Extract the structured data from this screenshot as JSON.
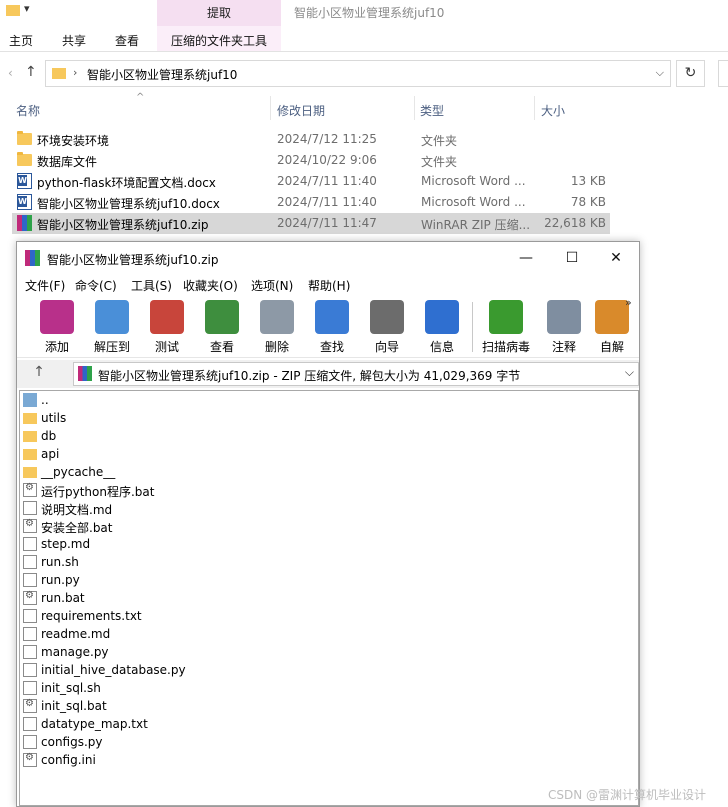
{
  "explorer": {
    "window_title": "智能小区物业管理系统juf10",
    "context_tab_group": "提取",
    "tabs": [
      "主页",
      "共享",
      "查看",
      "压缩的文件夹工具"
    ],
    "address": "智能小区物业管理系统juf10",
    "columns": [
      "名称",
      "修改日期",
      "类型",
      "大小"
    ],
    "files": [
      {
        "name": "环境安装环境",
        "date": "2024/7/12 11:25",
        "type": "文件夹",
        "size": "",
        "icon": "folder-icon"
      },
      {
        "name": "数据库文件",
        "date": "2024/10/22 9:06",
        "type": "文件夹",
        "size": "",
        "icon": "folder-icon"
      },
      {
        "name": "python-flask环境配置文档.docx",
        "date": "2024/7/11 11:40",
        "type": "Microsoft Word ...",
        "size": "13 KB",
        "icon": "word-icon"
      },
      {
        "name": "智能小区物业管理系统juf10.docx",
        "date": "2024/7/11 11:40",
        "type": "Microsoft Word ...",
        "size": "78 KB",
        "icon": "word-icon"
      },
      {
        "name": "智能小区物业管理系统juf10.zip",
        "date": "2024/7/11 11:47",
        "type": "WinRAR ZIP 压缩...",
        "size": "22,618 KB",
        "icon": "winrar-icon",
        "selected": true
      }
    ]
  },
  "winrar": {
    "title": "智能小区物业管理系统juf10.zip",
    "window_buttons": [
      "—",
      "☐",
      "✕"
    ],
    "menu": [
      "文件(F)",
      "命令(C)",
      "工具(S)",
      "收藏夹(O)",
      "选项(N)",
      "帮助(H)"
    ],
    "toolbar": [
      {
        "label": "添加",
        "icon": "add-archive-icon",
        "color": "#b8308a"
      },
      {
        "label": "解压到",
        "icon": "extract-folder-icon",
        "color": "#4a8fd8"
      },
      {
        "label": "测试",
        "icon": "test-clipboard-icon",
        "color": "#c8453b"
      },
      {
        "label": "查看",
        "icon": "view-book-icon",
        "color": "#3e8e3e"
      },
      {
        "label": "删除",
        "icon": "trash-icon",
        "color": "#8d99a6"
      },
      {
        "label": "查找",
        "icon": "magnifier-icon",
        "color": "#3a7bd5"
      },
      {
        "label": "向导",
        "icon": "wizard-wand-icon",
        "color": "#6c6c6c"
      },
      {
        "label": "信息",
        "icon": "info-icon",
        "color": "#2f6fd0"
      },
      {
        "label": "扫描病毒",
        "icon": "virus-scan-icon",
        "color": "#3a9a2f"
      },
      {
        "label": "注释",
        "icon": "comment-icon",
        "color": "#7f8ea0"
      },
      {
        "label": "自解",
        "icon": "sfx-icon",
        "color": "#d98a2b"
      }
    ],
    "path_text": "智能小区物业管理系统juf10.zip - ZIP 压缩文件, 解包大小为 41,029,369 字节",
    "entries": [
      {
        "name": "..",
        "icon": "up-folder-icon"
      },
      {
        "name": "utils",
        "icon": "folder-icon"
      },
      {
        "name": "db",
        "icon": "folder-icon"
      },
      {
        "name": "api",
        "icon": "folder-icon"
      },
      {
        "name": "__pycache__",
        "icon": "folder-icon"
      },
      {
        "name": "运行python程序.bat",
        "icon": "batch-file-icon"
      },
      {
        "name": "说明文档.md",
        "icon": "file-icon"
      },
      {
        "name": "安装全部.bat",
        "icon": "batch-file-icon"
      },
      {
        "name": "step.md",
        "icon": "file-icon"
      },
      {
        "name": "run.sh",
        "icon": "file-icon"
      },
      {
        "name": "run.py",
        "icon": "file-icon"
      },
      {
        "name": "run.bat",
        "icon": "batch-file-icon"
      },
      {
        "name": "requirements.txt",
        "icon": "file-icon"
      },
      {
        "name": "readme.md",
        "icon": "file-icon"
      },
      {
        "name": "manage.py",
        "icon": "file-icon"
      },
      {
        "name": "initial_hive_database.py",
        "icon": "file-icon"
      },
      {
        "name": "init_sql.sh",
        "icon": "file-icon"
      },
      {
        "name": "init_sql.bat",
        "icon": "batch-file-icon"
      },
      {
        "name": "datatype_map.txt",
        "icon": "file-icon"
      },
      {
        "name": "configs.py",
        "icon": "file-icon"
      },
      {
        "name": "config.ini",
        "icon": "settings-file-icon"
      }
    ]
  },
  "watermark": "CSDN @雷渊计算机毕业设计"
}
